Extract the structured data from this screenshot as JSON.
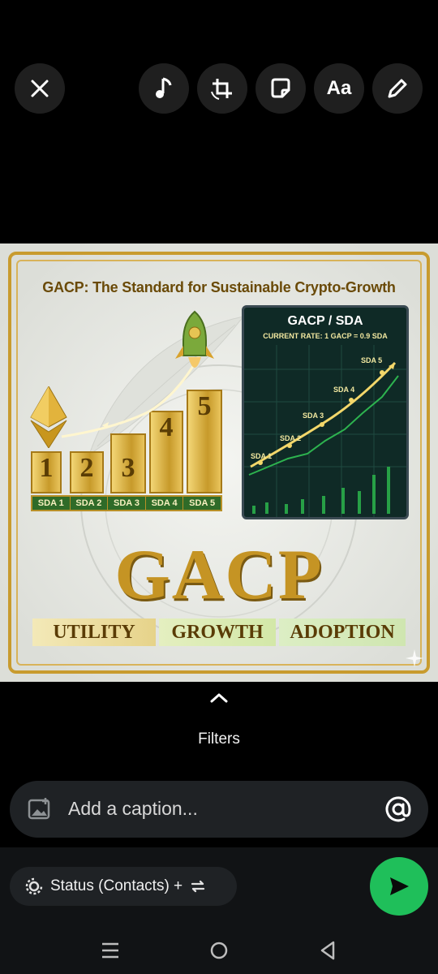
{
  "toolbar": {
    "close": "close-icon",
    "music": "music-note-icon",
    "crop": "crop-rotate-icon",
    "sticker": "sticker-icon",
    "text": "Aa",
    "draw": "pencil-icon"
  },
  "image": {
    "headline": "GACP: The Standard for Sustainable Crypto-Growth",
    "bars": [
      "1",
      "2",
      "3",
      "4",
      "5"
    ],
    "sda_labels": [
      "SDA 1",
      "SDA 2",
      "SDA 3",
      "SDA 4",
      "SDA 5"
    ],
    "panel_title": "GACP / SDA",
    "panel_rate": "CURRENT RATE: 1 GACP = 0.9 SDA",
    "points": [
      "SDA 1",
      "SDA 2",
      "SDA 3",
      "SDA 4",
      "SDA 5"
    ],
    "brand": "GACP",
    "pillars": [
      "UTILITY",
      "GROWTH",
      "ADOPTION"
    ]
  },
  "filters": {
    "label": "Filters"
  },
  "caption": {
    "placeholder": "Add a caption..."
  },
  "status": {
    "label": "Status (Contacts) +"
  },
  "colors": {
    "send": "#1fbf5a",
    "gold": "#c59424",
    "background": "#000000"
  }
}
